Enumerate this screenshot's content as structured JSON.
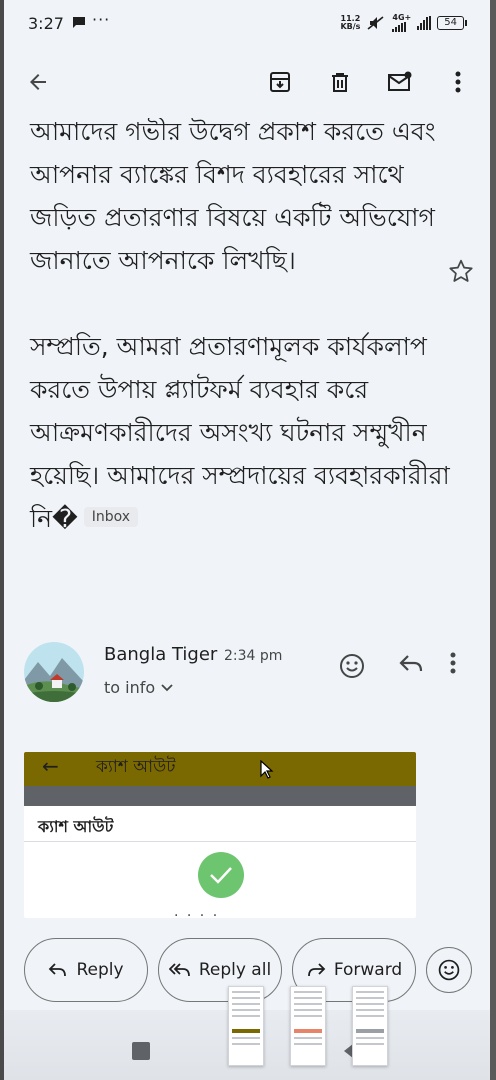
{
  "status_bar": {
    "time": "3:27",
    "dots": "···",
    "net_speed_value": "11.2",
    "net_speed_unit": "KB/s",
    "network_type": "4G+",
    "battery": "54"
  },
  "toolbar": {
    "back_icon": "arrow-back-icon",
    "archive_icon": "archive-icon",
    "delete_icon": "delete-icon",
    "unread_icon": "mark-unread-icon",
    "more_icon": "more-vert-icon"
  },
  "email": {
    "paragraph1": "আমাদের গভীর উদ্বেগ প্রকাশ করতে এবং আপনার ব্যাঙ্কের বিশদ ব্যবহারের সাথে জড়িত প্রতারণার বিষয়ে একটি অভিযোগ জানাতে আপনাকে লিখছি।",
    "paragraph2": "সম্প্রতি, আমরা প্রতারণামূলক কার্যকলাপ করতে উপায় প্ল্যাটফর্ম ব্যবহার করে আক্রমণকারীদের অসংখ্য ঘটনার সম্মুখীন হয়েছি। আমাদের সম্প্রদায়ের ব্যবহারকারীরা নি�",
    "label_chip": "Inbox"
  },
  "sender": {
    "name": "Bangla Tiger",
    "time": "2:34 pm",
    "to": "to info"
  },
  "attachment": {
    "header_title": "ক্যাশ আউট",
    "subtitle": "ক্যাশ আউট",
    "truncated_text": "· · · ·"
  },
  "actions": {
    "reply": "Reply",
    "reply_all": "Reply all",
    "forward": "Forward"
  },
  "colors": {
    "background": "#f0f4f9",
    "text": "#1f1f1f",
    "attachment_header": "#7a6800",
    "success_check": "#6ec56f"
  }
}
